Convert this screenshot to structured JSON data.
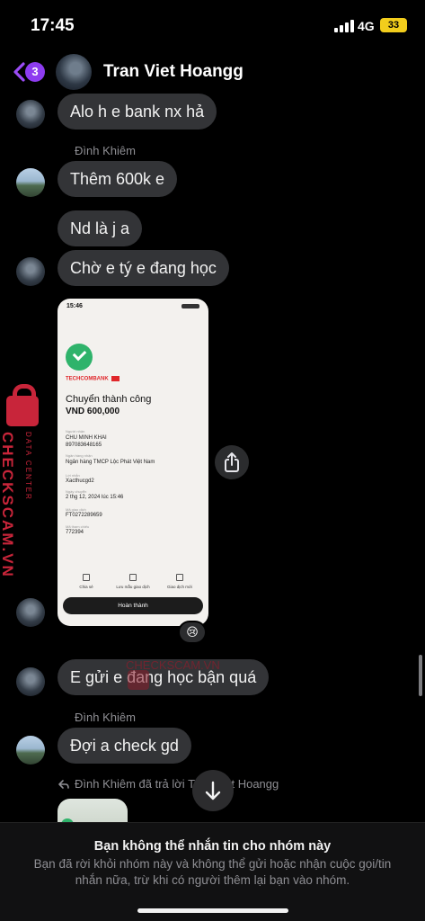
{
  "status_bar": {
    "time": "17:45",
    "network": "4G",
    "battery": "33"
  },
  "header": {
    "back_badge": "3",
    "title": "Tran Viet Hoangg"
  },
  "messages": [
    {
      "text": "Alo h e bank nx hả"
    },
    {
      "sender": "Đình Khiêm",
      "text": "Thêm 600k e"
    },
    {
      "text": "Nd là j a"
    },
    {
      "text": "Chờ e tý e đang học"
    },
    {
      "text": "E gửi e đang học bận quá"
    },
    {
      "sender": "Đình Khiêm",
      "text": "Đợi a check gd"
    }
  ],
  "receipt": {
    "time": "15:46",
    "bank": "TECHCOMBANK",
    "title": "Chuyển thành công",
    "amount": "VND 600,000",
    "fields": [
      {
        "label": "Người nhận",
        "value": "CHU MINH KHAI\n897083648165"
      },
      {
        "label": "Ngân hàng nhận",
        "value": "Ngân hàng TMCP Lộc Phát Việt Nam"
      },
      {
        "label": "Lời nhắn",
        "value": "Xacthucgd2"
      },
      {
        "label": "Ngày chuyển",
        "value": "2 thg 12, 2024 lúc 15:46"
      },
      {
        "label": "Mã giao dịch",
        "value": "FT0272289659"
      },
      {
        "label": "Mã tham chiếu",
        "value": "772394"
      }
    ],
    "actions": [
      "Chia sẻ",
      "Lưu mẫu giao dịch",
      "Giao dịch mới"
    ],
    "done_label": "Hoàn thành"
  },
  "reaction": "😢",
  "watermark": {
    "main": "CHECKSCAM.VN",
    "sub": "DATA CENTER",
    "center": "CHECKSCAM.VN"
  },
  "reply": {
    "text": "Đình Khiêm đã trả lời Tran Viet Hoangg"
  },
  "notice": {
    "title": "Bạn không thể nhắn tin cho nhóm này",
    "body": "Bạn đã rời khỏi nhóm này và không thể gửi hoặc nhận cuộc gọi/tin nhắn nữa, trừ khi có người thêm lại bạn vào nhóm."
  }
}
